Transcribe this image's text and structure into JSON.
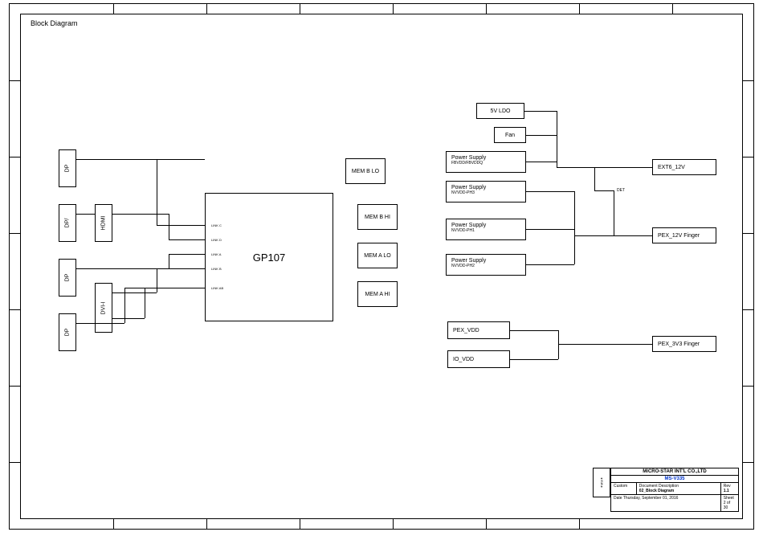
{
  "title": "Block Diagram",
  "connectors": {
    "dp1": "DP",
    "dphdmi": "DP/",
    "hdmi": "HDMI",
    "dp2": "DP",
    "dvi": "DVI-I",
    "dp3": "DP"
  },
  "gpu": "GP107",
  "links": {
    "c": "LINK C",
    "d": "LINK D",
    "a": "LINK A",
    "b": "LINK B",
    "ab": "LINK AB"
  },
  "mem": {
    "b_lo": "MEM    B LO",
    "b_hi": "MEM    B HI",
    "a_lo": "MEM    A LO",
    "a_hi": "MEM    A HI"
  },
  "power": {
    "ldo": "5V LDO",
    "fan": "Fan",
    "ps_fb": {
      "title": "Power Supply",
      "sub": "FBVDD/FBVDDQ"
    },
    "ps_ph3": {
      "title": "Power Supply",
      "sub": "NVVDD-PH3"
    },
    "ps_ph1": {
      "title": "Power Supply",
      "sub": "NVVDD-PH1"
    },
    "ps_ph2": {
      "title": "Power Supply",
      "sub": "NVVDD-PH2"
    },
    "ext6": "EXT6_12V",
    "det": "DET",
    "pex12v": "PEX_12V Finger",
    "pex_vdd": "PEX_VDD",
    "io_vdd": "IO_VDD",
    "pex3v3": "PEX_3V3 Finger"
  },
  "titleblock": {
    "company": "MICRO-STAR INT'L CO.,LTD",
    "model": "MS-V335",
    "doc_label": "Document  Description",
    "doc": "02_Block Diagram",
    "rev_label": "Rev",
    "rev": "1.1",
    "custom": "Custom",
    "date": "Date   Thursday, September 01, 2016",
    "sheet": "Sheet    2    of    30"
  }
}
